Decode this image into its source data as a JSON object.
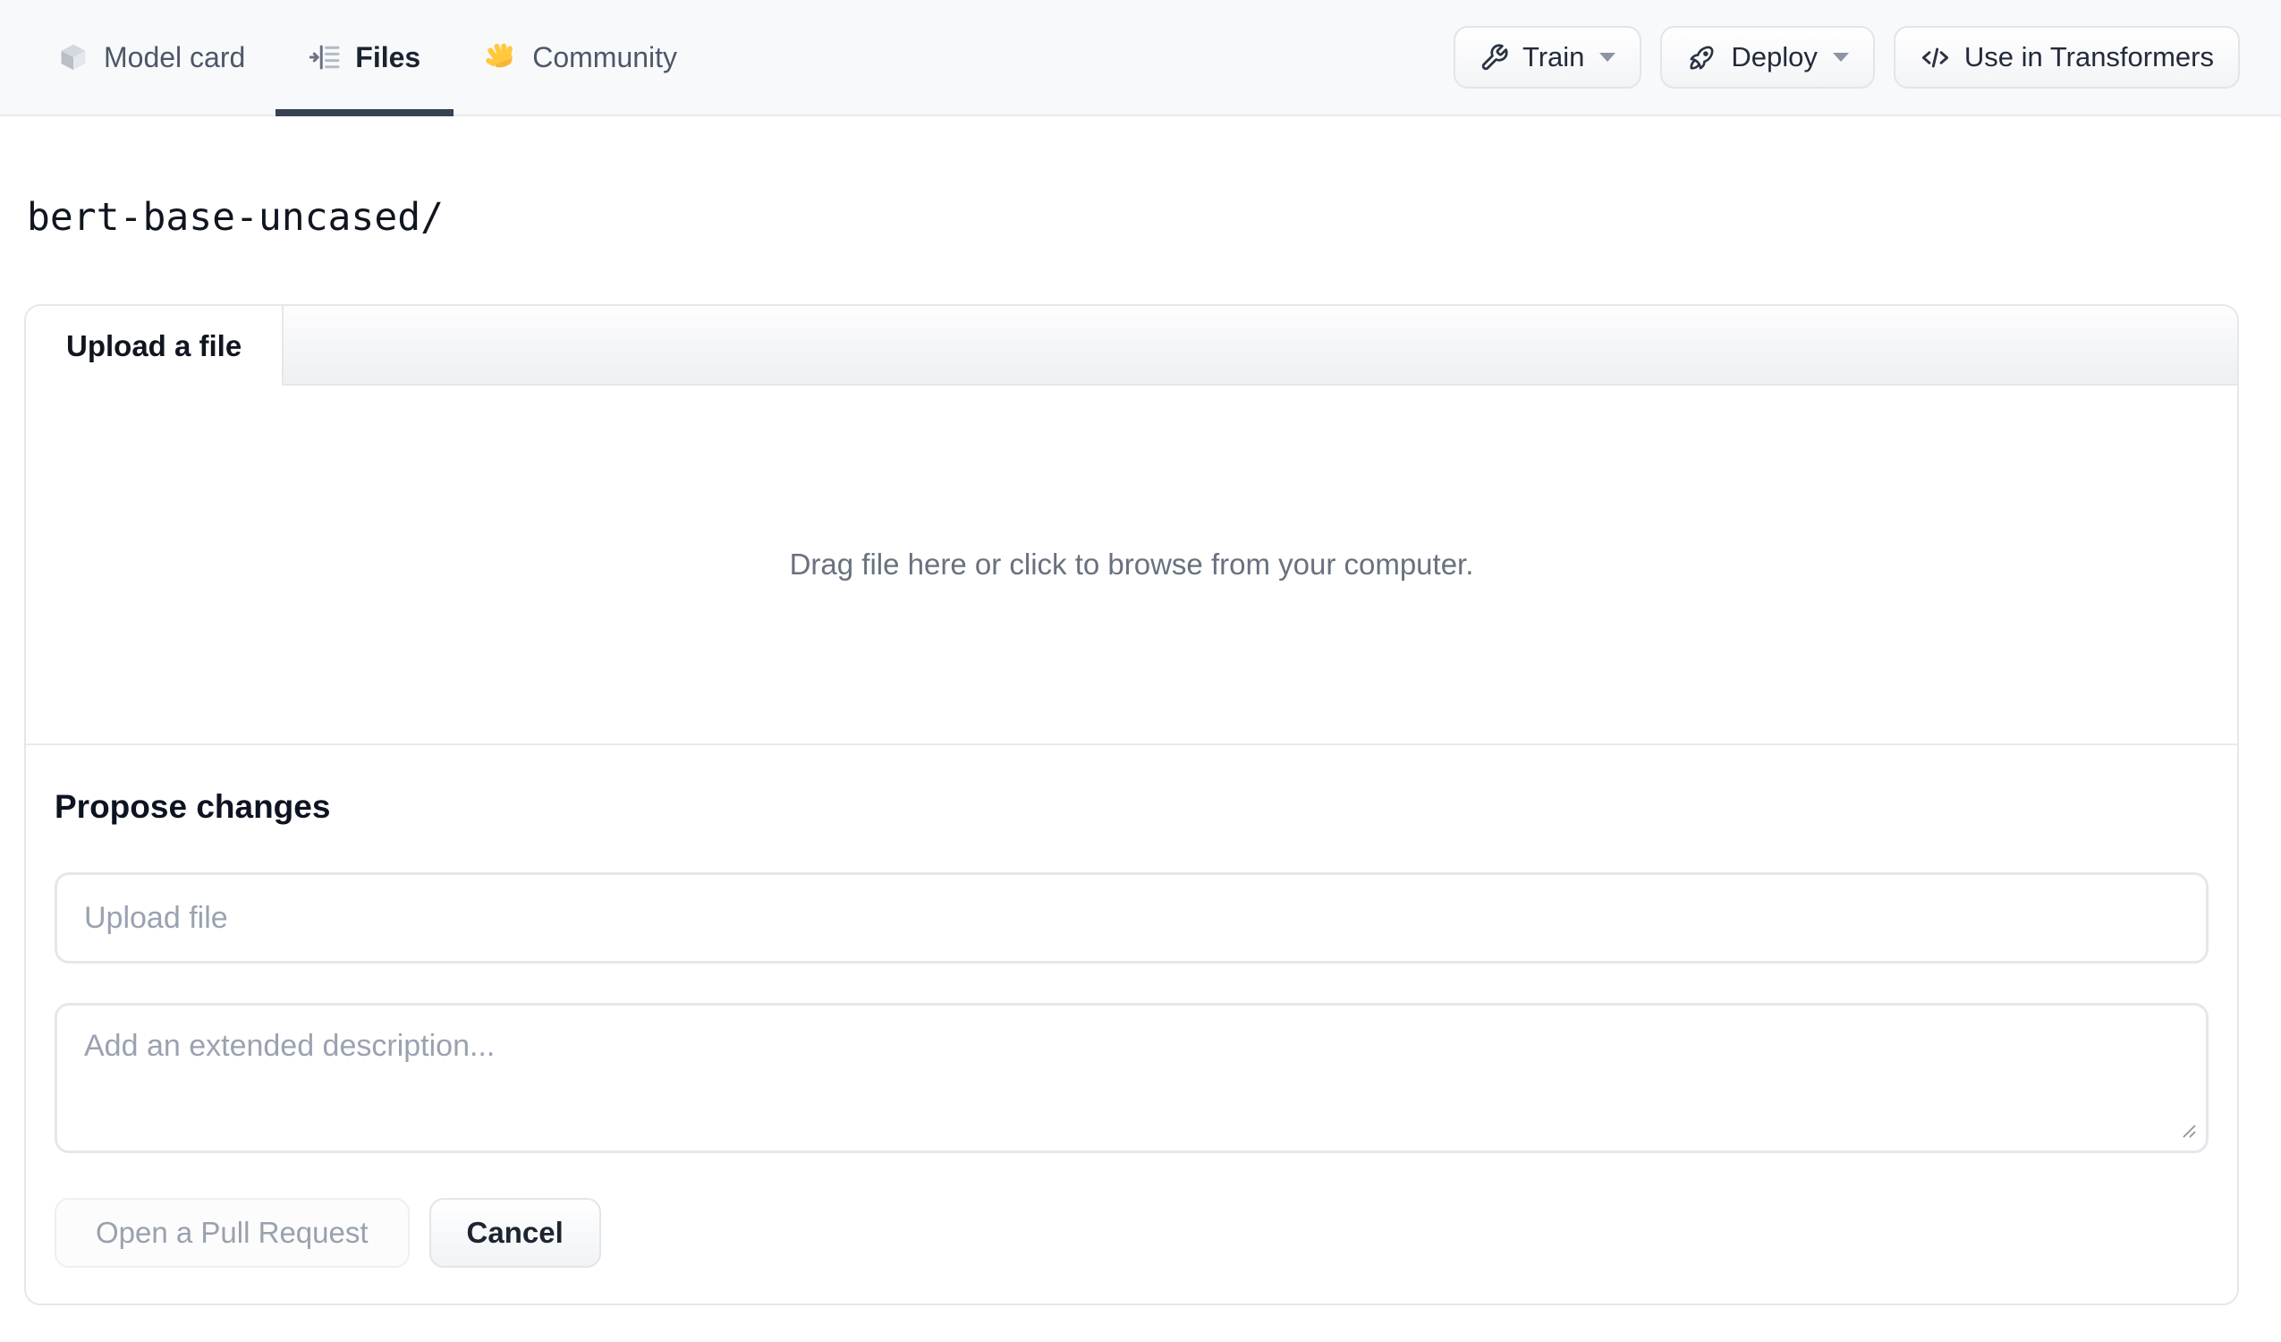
{
  "nav": {
    "tabs": [
      {
        "label": "Model card",
        "icon": "cube-icon",
        "active": false
      },
      {
        "label": "Files",
        "icon": "versions-icon",
        "active": true
      },
      {
        "label": "Community",
        "icon": "waving-hand-icon",
        "active": false
      }
    ],
    "actions": [
      {
        "label": "Train",
        "icon": "wrench-icon",
        "has_dropdown": true
      },
      {
        "label": "Deploy",
        "icon": "rocket-icon",
        "has_dropdown": true
      },
      {
        "label": "Use in Transformers",
        "icon": "code-icon",
        "has_dropdown": false
      }
    ]
  },
  "breadcrumb": {
    "path": "bert-base-uncased/"
  },
  "upload_card": {
    "tab_label": "Upload a file",
    "dropzone_text": "Drag file here or click to browse from your computer.",
    "propose": {
      "heading": "Propose changes",
      "file_input_value": "",
      "file_input_placeholder": "Upload file",
      "description_value": "",
      "description_placeholder": "Add an extended description...",
      "primary_button_label": "Open a Pull Request",
      "secondary_button_label": "Cancel"
    }
  },
  "colors": {
    "navbar_bg": "#f8f9fb",
    "active_tab_underline": "#364252",
    "card_border": "#e5e7eb",
    "placeholder_text": "#9aa2b1",
    "muted_text": "#68717f",
    "disabled_button_text": "#99a1ad",
    "dark_text": "#1b2330"
  }
}
